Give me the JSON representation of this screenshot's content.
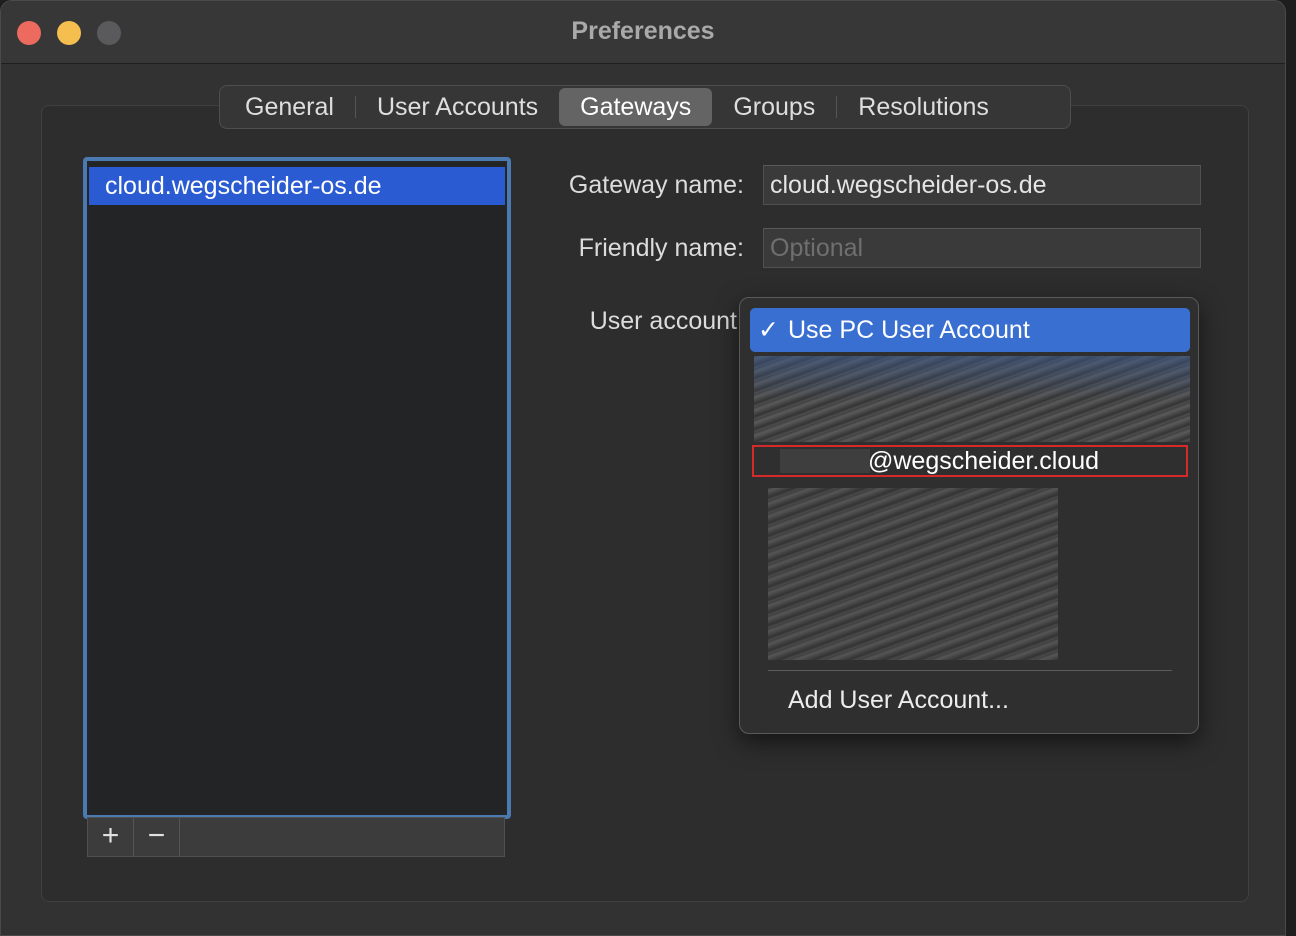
{
  "window": {
    "title": "Preferences"
  },
  "tabs": [
    {
      "label": "General",
      "active": false
    },
    {
      "label": "User Accounts",
      "active": false
    },
    {
      "label": "Gateways",
      "active": true
    },
    {
      "label": "Groups",
      "active": false
    },
    {
      "label": "Resolutions",
      "active": false
    }
  ],
  "gateway_list": {
    "items": [
      "cloud.wegscheider-os.de"
    ],
    "selected": "cloud.wegscheider-os.de",
    "add_label": "+",
    "remove_label": "−"
  },
  "form": {
    "gateway_name_label": "Gateway name:",
    "gateway_name_value": "cloud.wegscheider-os.de",
    "friendly_name_label": "Friendly name:",
    "friendly_name_placeholder": "Optional",
    "user_account_label": "User account"
  },
  "user_account_menu": {
    "selected_check": "✓",
    "selected_label": "Use PC User Account",
    "email_item_label": "@wegscheider.cloud",
    "add_item_label": "Add User Account..."
  },
  "colors": {
    "accent": "#3a6fd2",
    "list_selection": "#2a5bd3",
    "focus_ring": "#4a7ab0",
    "highlight_box": "#d62a2a",
    "close": "#ec6a5e",
    "minimize": "#f4bf4f"
  }
}
